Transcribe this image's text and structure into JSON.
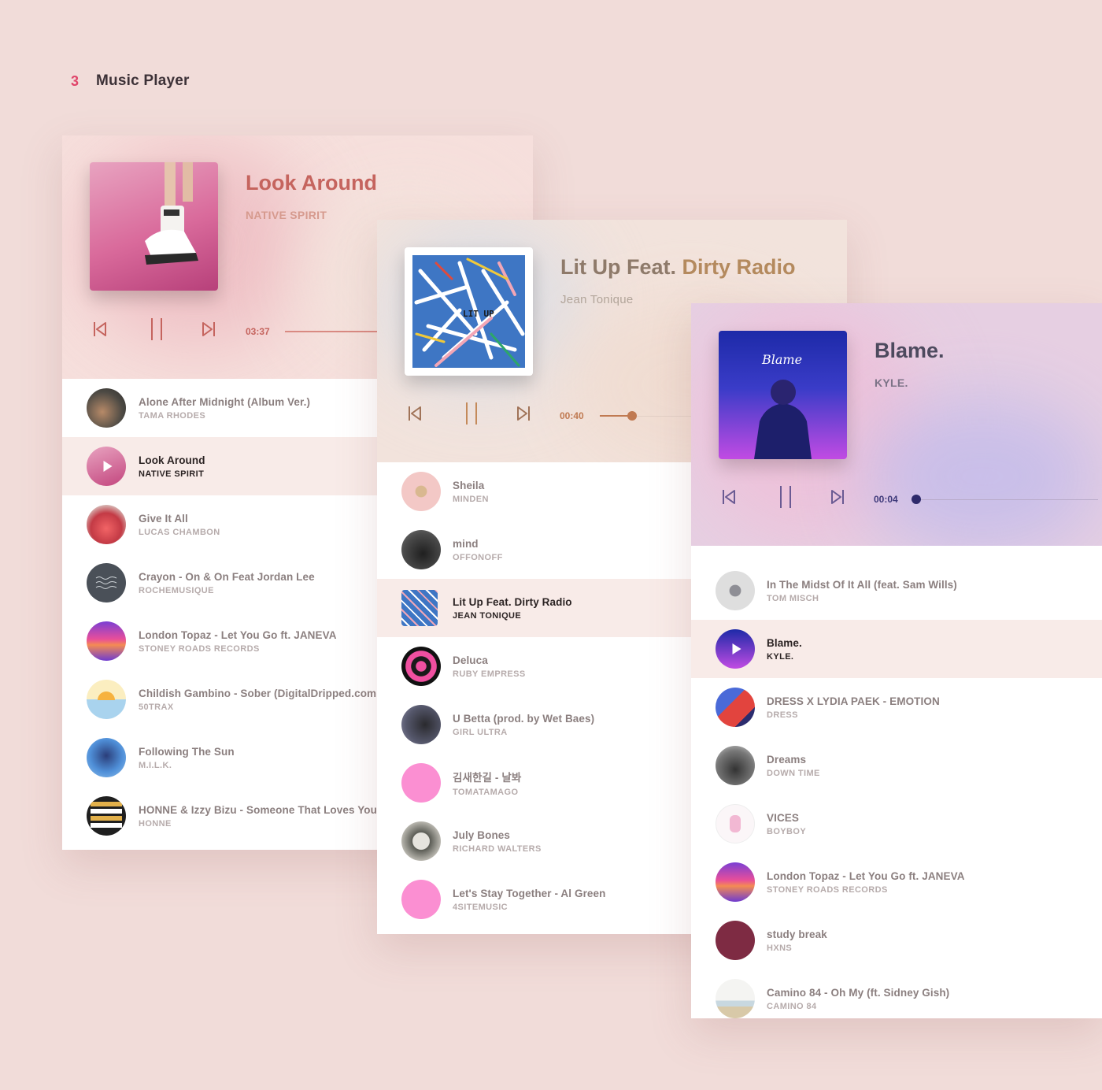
{
  "header": {
    "number": "3",
    "title": "Music Player"
  },
  "players": [
    {
      "now_playing": {
        "title": "Look Around",
        "artist": "NATIVE SPIRIT",
        "time": "03:37"
      },
      "accent": "#c5645e",
      "tracks": [
        {
          "title": "Alone After Midnight (Album Ver.)",
          "artist": "TAMA RHODES"
        },
        {
          "title": "Look Around",
          "artist": "NATIVE SPIRIT"
        },
        {
          "title": "Give It All",
          "artist": "LUCAS CHAMBON"
        },
        {
          "title": "Crayon - On & On Feat Jordan Lee",
          "artist": "ROCHEMUSIQUE"
        },
        {
          "title": "London Topaz - Let You Go ft. JANEVA",
          "artist": "STONEY ROADS RECORDS"
        },
        {
          "title": "Childish Gambino - Sober (DigitalDripped.com",
          "artist": "50TRAX"
        },
        {
          "title": "Following The Sun",
          "artist": "M.I.L.K."
        },
        {
          "title": "HONNE & Izzy Bizu - Someone That Loves You",
          "artist": "HONNE"
        }
      ]
    },
    {
      "now_playing": {
        "title_part1": "Lit Up Feat.",
        "title_part2": "Dirty Radio",
        "artist": "Jean Tonique",
        "time": "00:40"
      },
      "cover_text": "LIT UP",
      "accent": "#c07a52",
      "tracks": [
        {
          "title": "Sheila",
          "artist": "MINDEN"
        },
        {
          "title": "mind",
          "artist": "OFFONOFF"
        },
        {
          "title": "Lit Up Feat. Dirty Radio",
          "artist": "JEAN TONIQUE"
        },
        {
          "title": "Deluca",
          "artist": "RUBY EMPRESS"
        },
        {
          "title": "U Betta (prod. by Wet Baes)",
          "artist": "GIRL ULTRA"
        },
        {
          "title": "김새한길 - 날봐",
          "artist": "TOMATAMAGO"
        },
        {
          "title": "July Bones",
          "artist": "RICHARD WALTERS"
        },
        {
          "title": "Let's Stay Together - Al Green",
          "artist": "4SITEMUSIC"
        }
      ]
    },
    {
      "now_playing": {
        "title": "Blame.",
        "artist": "KYLE.",
        "time": "00:04"
      },
      "cover_text": "Blame",
      "accent": "#3e3a7a",
      "tracks": [
        {
          "title": "In The Midst Of It All (feat. Sam Wills)",
          "artist": "TOM MISCH"
        },
        {
          "title": "Blame.",
          "artist": "KYLE."
        },
        {
          "title": "DRESS X LYDIA PAEK - EMOTION",
          "artist": "DRESS"
        },
        {
          "title": "Dreams",
          "artist": "DOWN TIME"
        },
        {
          "title": "VICES",
          "artist": "BOYBOY"
        },
        {
          "title": "London Topaz - Let You Go ft. JANEVA",
          "artist": "STONEY ROADS RECORDS"
        },
        {
          "title": "study break",
          "artist": "HXNS"
        },
        {
          "title": "Camino 84 - Oh My (ft. Sidney Gish)",
          "artist": "CAMINO 84"
        }
      ]
    }
  ]
}
